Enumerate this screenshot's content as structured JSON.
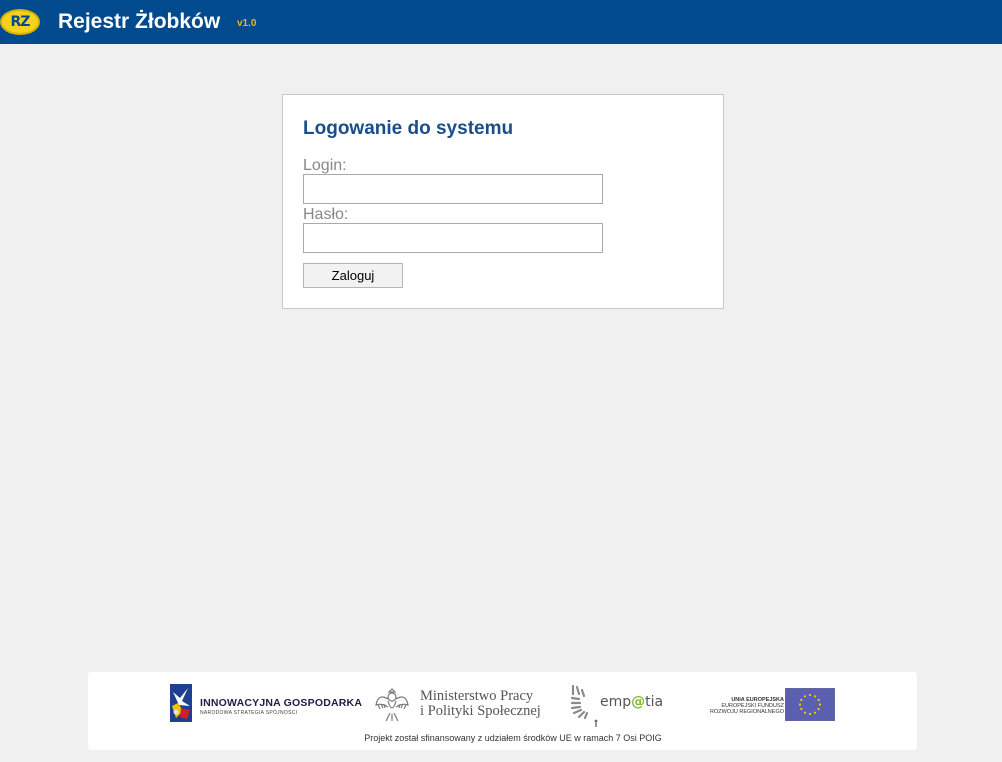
{
  "header": {
    "logo_text": "RZ",
    "title": "Rejestr Żłobków",
    "version": "v1.0",
    "colors": {
      "bar": "#004a8d",
      "logo": "#f4d21f",
      "version": "#f2b41a"
    }
  },
  "login": {
    "title": "Logowanie do systemu",
    "login_label": "Login:",
    "login_value": "",
    "password_label": "Hasło:",
    "password_value": "",
    "submit_label": "Zaloguj",
    "title_color": "#1a4d8a"
  },
  "footer": {
    "logo_innowacyjna": {
      "name": "INNOWACYJNA GOSPODARKA",
      "subtitle": "NARODOWA STRATEGIA SPÓJNOŚCI",
      "icon": "innowacyjna-gospodarka-icon"
    },
    "logo_ministerstwo": {
      "line1": "Ministerstwo Pracy",
      "line2": "i Polityki Społecznej",
      "icon": "polish-eagle-icon"
    },
    "logo_empatia": {
      "prefix": "emp",
      "at": "@",
      "suffix": "tia",
      "icon": "empatia-icon"
    },
    "logo_ue": {
      "line1": "UNIA EUROPEJSKA",
      "line2": "EUROPEJSKI FUNDUSZ",
      "line3": "ROZWOJU REGIONALNEGO",
      "icon": "eu-flag-icon"
    },
    "note": "Projekt został sfinansowany z udziałem środków UE w ramach 7 Osi POIG"
  }
}
